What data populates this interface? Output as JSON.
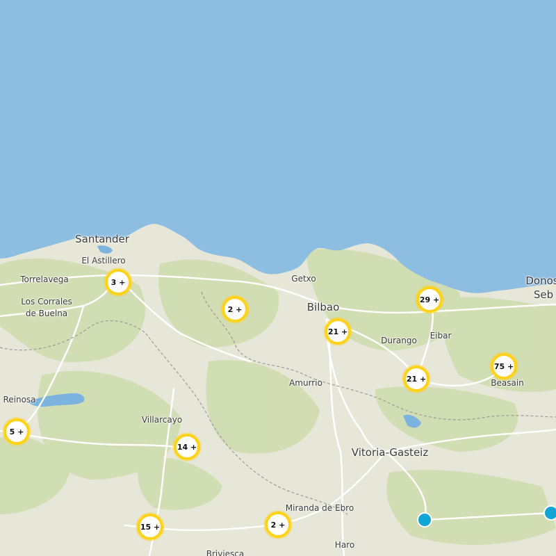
{
  "map": {
    "colors": {
      "sea": "#8dbde0",
      "land": "#e6e7d8",
      "forest": "#cfdcaf",
      "road": "#ffffff",
      "border": "#9a9a9a",
      "water": "#7cb3df"
    },
    "places": [
      {
        "name": "Santander"
      },
      {
        "name": "El Astillero"
      },
      {
        "name": "Torrelavega"
      },
      {
        "name": "Los Corrales"
      },
      {
        "name": "de Buelna"
      },
      {
        "name": "Reinosa"
      },
      {
        "name": "Villarcayo"
      },
      {
        "name": "Getxo"
      },
      {
        "name": "Bilbao"
      },
      {
        "name": "Durango"
      },
      {
        "name": "Eibar"
      },
      {
        "name": "Amurrio"
      },
      {
        "name": "Beasain"
      },
      {
        "name": "Donos"
      },
      {
        "name": "Seb"
      },
      {
        "name": "Vitoria-Gasteiz"
      },
      {
        "name": "Miranda de Ebro"
      },
      {
        "name": "Haro"
      },
      {
        "name": "Briviesca"
      }
    ],
    "clusters": [
      {
        "label": "3 +"
      },
      {
        "label": "2 +"
      },
      {
        "label": "21 +"
      },
      {
        "label": "29 +"
      },
      {
        "label": "21 +"
      },
      {
        "label": "75 +"
      },
      {
        "label": "5 +"
      },
      {
        "label": "14 +"
      },
      {
        "label": "15 +"
      },
      {
        "label": "2 +"
      }
    ],
    "markers": [
      {
        "icon": "location-marker-icon"
      },
      {
        "icon": "location-marker-icon"
      }
    ]
  }
}
